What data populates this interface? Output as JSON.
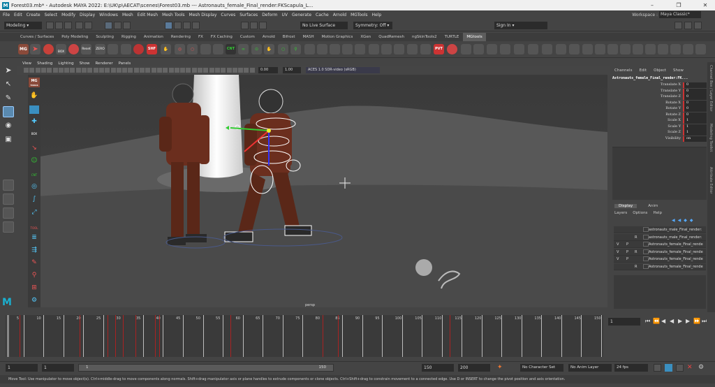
{
  "window": {
    "title": "Forest03.mb* - Autodesk MAYA 2022: E:\\UK\\p\\AECAT\\scenes\\Forest03.mb   ---   Astronauts_female_Final_render:FKScapula_L...",
    "logo": "M"
  },
  "menu": [
    "File",
    "Edit",
    "Create",
    "Select",
    "Modify",
    "Display",
    "Windows",
    "Mesh",
    "Edit Mesh",
    "Mesh Tools",
    "Mesh Display",
    "Curves",
    "Surfaces",
    "Deform",
    "UV",
    "Generate",
    "Cache",
    "Arnold",
    "MGTools",
    "Help"
  ],
  "workspace": {
    "label": "Workspace :",
    "value": "Maya Classic*"
  },
  "statusline": {
    "mode": "Modeling",
    "live_surface": "No Live Surface",
    "symmetry": "Symmetry: Off",
    "sign_in": "Sign In"
  },
  "shelf_tabs": [
    "Curves / Surfaces",
    "Poly Modeling",
    "Sculpting",
    "Rigging",
    "Animation",
    "Rendering",
    "FX",
    "FX Caching",
    "Custom",
    "Arnold",
    "Bifrost",
    "MASH",
    "Motion Graphics",
    "XGen",
    "QuadRemesh",
    "ngSkinTools2",
    "TURTLE",
    "MGtools"
  ],
  "active_shelf": "MGtools",
  "shelf_labels": {
    "mg": "MG",
    "box": "BOX",
    "reset": "Reset",
    "zero": "ZERO",
    "shf": "SHF",
    "cnt": "CNT",
    "pvt": "PVT"
  },
  "panel_menu": [
    "View",
    "Shading",
    "Lighting",
    "Show",
    "Renderer",
    "Panels"
  ],
  "panel_toolbar": {
    "exposure": "0.00",
    "gamma": "1.00",
    "colorspace": "ACES 1.0 SDR-video (sRGB)"
  },
  "viewport": {
    "camera": "persp"
  },
  "left_shelf_labels": {
    "mg": "MG",
    "tools": "TOOLS",
    "box": "BOX",
    "cnt": "CNT",
    "tool": "TOOL"
  },
  "channel_box": {
    "menu": [
      "Channels",
      "Edit",
      "Object",
      "Show"
    ],
    "object": "Astronauts_female_Final_render:FK...",
    "channels": [
      {
        "name": "Translate X",
        "value": "0"
      },
      {
        "name": "Translate Y",
        "value": "0"
      },
      {
        "name": "Translate Z",
        "value": "0"
      },
      {
        "name": "Rotate X",
        "value": "0"
      },
      {
        "name": "Rotate Y",
        "value": "0"
      },
      {
        "name": "Rotate Z",
        "value": "0"
      },
      {
        "name": "Scale X",
        "value": "1"
      },
      {
        "name": "Scale Y",
        "value": "1"
      },
      {
        "name": "Scale Z",
        "value": "1"
      },
      {
        "name": "Visibility",
        "value": "on"
      }
    ]
  },
  "side_tabs": [
    "Channel Box / Layer Editor",
    "Modeling Toolkit",
    "Attribute Editor"
  ],
  "layer_editor": {
    "tabs": [
      "Display",
      "Anim"
    ],
    "menu": [
      "Layers",
      "Options",
      "Help"
    ],
    "layers": [
      {
        "v": "",
        "p": "",
        "r": "",
        "name": "astronauts_male_Final_render:"
      },
      {
        "v": "",
        "p": "",
        "r": "R",
        "name": "astronauts_male_Final_render:"
      },
      {
        "v": "V",
        "p": "P",
        "r": "",
        "name": "Astronauts_female_Final_rende"
      },
      {
        "v": "V",
        "p": "P",
        "r": "R",
        "name": "Astronauts_female_Final_rende"
      },
      {
        "v": "V",
        "p": "P",
        "r": "",
        "name": "Astronauts_female_Final_rende"
      },
      {
        "v": "",
        "p": "",
        "r": "R",
        "name": "Astronauts_female_Final_rende"
      }
    ]
  },
  "timeline": {
    "ticks": [
      "5",
      "10",
      "15",
      "20",
      "25",
      "30",
      "35",
      "40",
      "45",
      "50",
      "55",
      "60",
      "65",
      "70",
      "75",
      "80",
      "85",
      "90",
      "95",
      "100",
      "105",
      "110",
      "115",
      "120",
      "125",
      "130",
      "135",
      "140",
      "145",
      "150"
    ],
    "current_frame": "1"
  },
  "range": {
    "start": "1",
    "playback_start": "1",
    "slider_start": "1",
    "slider_end": "150",
    "playback_end": "150",
    "end": "200",
    "character_set": "No Character Set",
    "anim_layer": "No Anim Layer",
    "fps": "24 fps"
  },
  "help_line": "Move Tool: Use manipulator to move object(s). Ctrl+middle-drag to move components along normals. Shift+drag manipulator axis or plane handles to extrude components or clone objects. Ctrl+Shift+drag to constrain movement to a connected edge. Use D or INSERT to change the pivot position and axis orientation."
}
